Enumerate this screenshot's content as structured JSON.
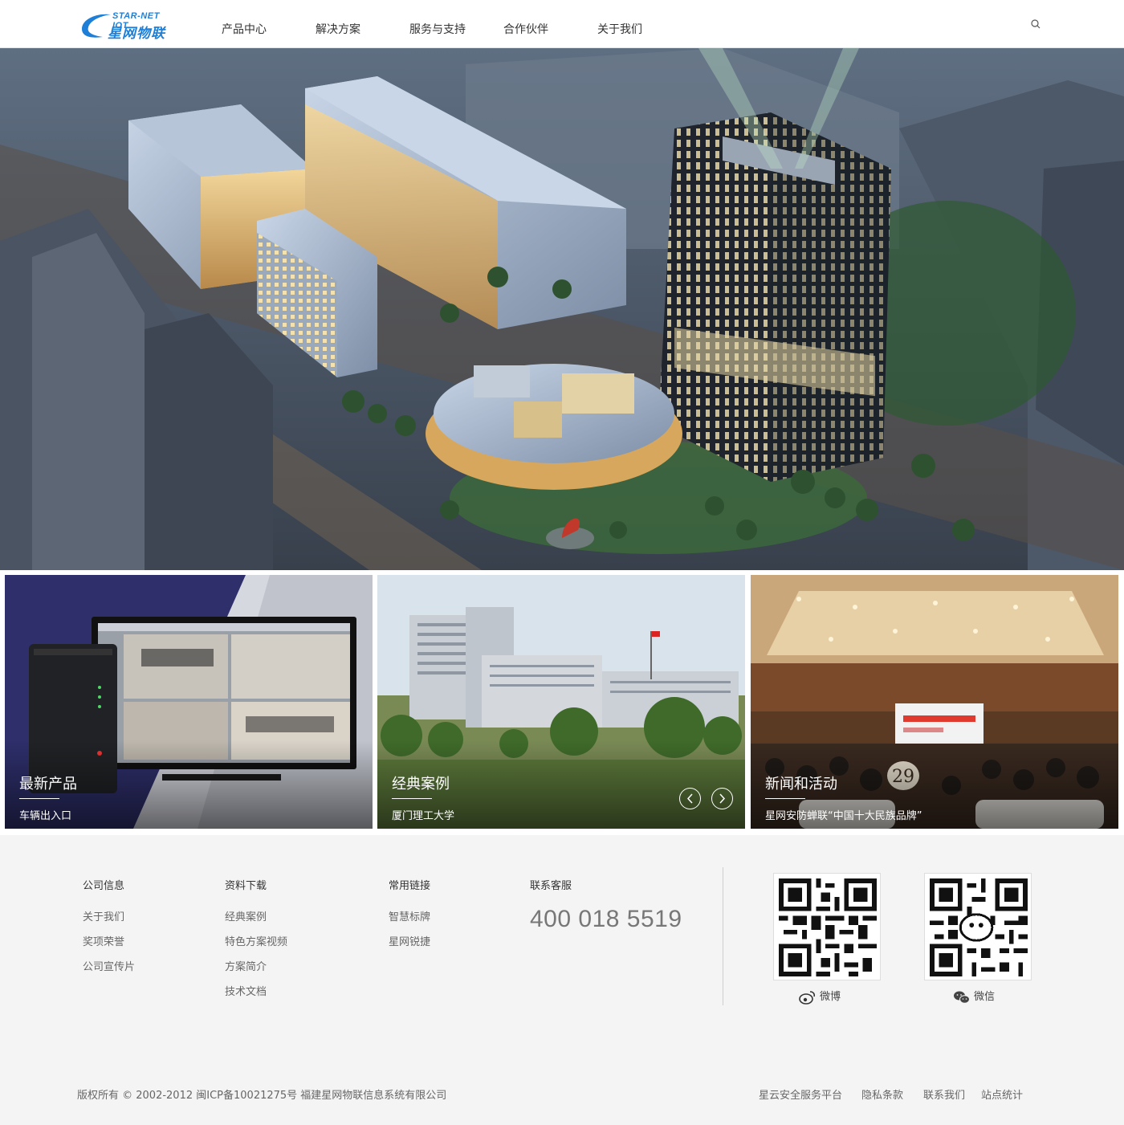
{
  "brand": {
    "name_en": "STAR-NET IOT",
    "name_cn": "星网物联",
    "color": "#1d7fd8"
  },
  "nav": {
    "items": [
      "产品中心",
      "解决方案",
      "服务与支持",
      "合作伙伴",
      "关于我们"
    ],
    "search_icon": "search-icon"
  },
  "cards": [
    {
      "title": "最新产品",
      "subtitle": "车辆出入口"
    },
    {
      "title": "经典案例",
      "subtitle": "厦门理工大学"
    },
    {
      "title": "新闻和活动",
      "subtitle": "星网安防蝉联“中国十大民族品牌”"
    }
  ],
  "footer": {
    "company": {
      "title": "公司信息",
      "links": [
        "关于我们",
        "奖项荣誉",
        "公司宣传片"
      ]
    },
    "downloads": {
      "title": "资料下载",
      "links": [
        "经典案例",
        "特色方案视频",
        "方案简介",
        "技术文档"
      ]
    },
    "links": {
      "title": "常用链接",
      "links": [
        "智慧标牌",
        "星网锐捷"
      ]
    },
    "contact": {
      "title": "联系客服",
      "phone": "400 018 5519"
    },
    "qr": [
      {
        "label": "微博",
        "icon": "weibo-icon"
      },
      {
        "label": "微信",
        "icon": "wechat-icon"
      }
    ],
    "copyright": "版权所有 © 2002-2012 闽ICP备10021275号 福建星网物联信息系统有限公司",
    "bottom_links": [
      "星云安全服务平台",
      "隐私条款",
      "联系我们",
      "站点统计"
    ]
  }
}
